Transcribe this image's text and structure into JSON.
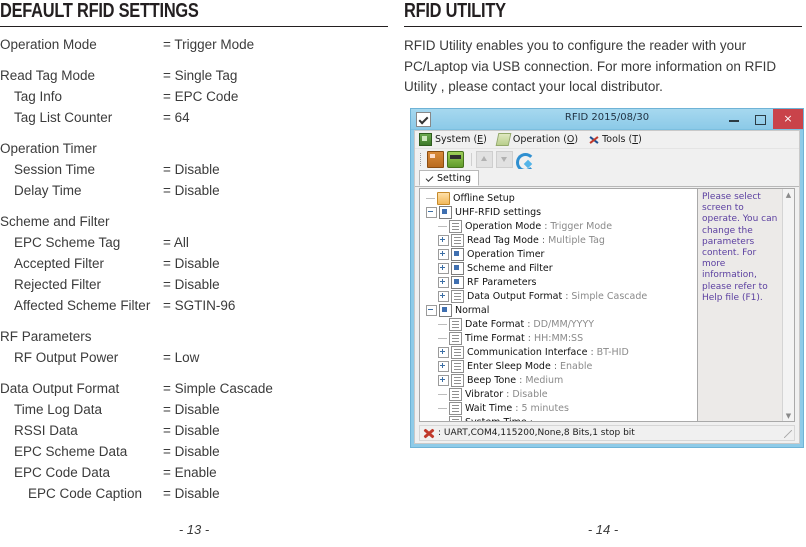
{
  "left": {
    "heading": "DEFAULT RFID SETTINGS",
    "rows": [
      {
        "label": "Operation Mode",
        "value": "= Trigger Mode",
        "indent": 0
      },
      {
        "spacer": true
      },
      {
        "label": "Read Tag Mode",
        "value": "= Single Tag",
        "indent": 0
      },
      {
        "label": "Tag Info",
        "value": "= EPC Code",
        "indent": 1
      },
      {
        "label": "Tag List Counter",
        "value": "= 64",
        "indent": 1
      },
      {
        "spacer": true
      },
      {
        "label": "Operation Timer",
        "value": "",
        "indent": 0
      },
      {
        "label": "Session Time",
        "value": "= Disable",
        "indent": 1
      },
      {
        "label": "Delay Time",
        "value": "= Disable",
        "indent": 1
      },
      {
        "spacer": true
      },
      {
        "label": "Scheme and Filter",
        "value": "",
        "indent": 0
      },
      {
        "label": "EPC Scheme Tag",
        "value": "= All",
        "indent": 1
      },
      {
        "label": "Accepted Filter",
        "value": "= Disable",
        "indent": 1
      },
      {
        "label": "Rejected Filter",
        "value": "= Disable",
        "indent": 1
      },
      {
        "label": "Affected Scheme Filter",
        "value": "= SGTIN-96",
        "indent": 1
      },
      {
        "spacer": true
      },
      {
        "label": "RF Parameters",
        "value": "",
        "indent": 0
      },
      {
        "label": "RF Output Power",
        "value": "= Low",
        "indent": 1
      },
      {
        "spacer": true
      },
      {
        "label": "Data Output Format",
        "value": "= Simple Cascade",
        "indent": 0
      },
      {
        "label": "Time Log Data",
        "value": "= Disable",
        "indent": 1
      },
      {
        "label": "RSSI Data",
        "value": "= Disable",
        "indent": 1
      },
      {
        "label": "EPC Scheme Data",
        "value": "= Disable",
        "indent": 1
      },
      {
        "label": "EPC Code Data",
        "value": "= Enable",
        "indent": 1
      },
      {
        "label": "EPC Code Caption",
        "value": "= Disable",
        "indent": 2
      }
    ],
    "page_number": "- 13 -"
  },
  "right": {
    "heading": "RFID UTILITY",
    "intro": "RFID Utility enables you to configure the reader with your PC/Laptop via USB connection. For more information on RFID Utility , please contact your local distributor.",
    "page_number": "- 14 -"
  },
  "app": {
    "title": "RFID 2015/08/30",
    "window_buttons": {
      "minimize": "–",
      "maximize": "□",
      "close": "×"
    },
    "menu": [
      {
        "text_before": "System (",
        "mnemonic": "E",
        "text_after": ")",
        "icon": "system-icon"
      },
      {
        "text_before": "Operation (",
        "mnemonic": "O",
        "text_after": ")",
        "icon": "operation-icon"
      },
      {
        "text_before": "Tools (",
        "mnemonic": "T",
        "text_after": ")",
        "icon": "tools-icon"
      }
    ],
    "toolbar": [
      {
        "icon": "book-icon",
        "enabled": true
      },
      {
        "icon": "device-icon",
        "enabled": true
      },
      {
        "icon": "upload-icon",
        "enabled": false
      },
      {
        "icon": "download-icon",
        "enabled": false
      },
      {
        "icon": "refresh-icon",
        "enabled": true
      }
    ],
    "tab": {
      "label": "Setting",
      "icon": "check-icon"
    },
    "tree": [
      {
        "depth": 0,
        "expander": "none",
        "icon": "folder-icon",
        "name": "Offline Setup",
        "value": ""
      },
      {
        "depth": 0,
        "expander": "minus",
        "icon": "blue-icon",
        "name": "UHF-RFID settings",
        "value": ""
      },
      {
        "depth": 1,
        "expander": "none",
        "icon": "page-icon",
        "name": "Operation Mode",
        "value": "Trigger Mode"
      },
      {
        "depth": 1,
        "expander": "plus",
        "icon": "page-icon",
        "name": "Read Tag Mode",
        "value": "Multiple Tag"
      },
      {
        "depth": 1,
        "expander": "plus",
        "icon": "blue-icon",
        "name": "Operation Timer",
        "value": ""
      },
      {
        "depth": 1,
        "expander": "plus",
        "icon": "blue-icon",
        "name": "Scheme and Filter",
        "value": ""
      },
      {
        "depth": 1,
        "expander": "plus",
        "icon": "blue-icon",
        "name": "RF Parameters",
        "value": ""
      },
      {
        "depth": 1,
        "expander": "plus",
        "icon": "page-icon",
        "name": "Data Output Format",
        "value": "Simple Cascade"
      },
      {
        "depth": 0,
        "expander": "minus",
        "icon": "blue-icon",
        "name": "Normal",
        "value": ""
      },
      {
        "depth": 1,
        "expander": "none",
        "icon": "page-icon",
        "name": "Date Format",
        "value": "DD/MM/YYYY"
      },
      {
        "depth": 1,
        "expander": "none",
        "icon": "page-icon",
        "name": "Time Format",
        "value": "HH:MM:SS"
      },
      {
        "depth": 1,
        "expander": "plus",
        "icon": "page-icon",
        "name": "Communication Interface",
        "value": "BT-HID"
      },
      {
        "depth": 1,
        "expander": "plus",
        "icon": "page-icon",
        "name": "Enter Sleep Mode",
        "value": "Enable"
      },
      {
        "depth": 1,
        "expander": "plus",
        "icon": "page-icon",
        "name": "Beep Tone",
        "value": "Medium"
      },
      {
        "depth": 1,
        "expander": "none",
        "icon": "page-icon",
        "name": "Vibrator",
        "value": "Disable"
      },
      {
        "depth": 1,
        "expander": "none",
        "icon": "page-icon",
        "name": "Wait Time",
        "value": "5 minutes"
      },
      {
        "depth": 1,
        "expander": "none",
        "icon": "page-icon",
        "name": "System Time",
        "value": ""
      }
    ],
    "help_text": "Please select screen to operate. You can change the parameters content. For more information, please refer to Help file (F1).",
    "status_text": ": UART,COM4,115200,None,8 Bits,1 stop bit",
    "colors": {
      "titlebar": "#8ecbe8",
      "close_button": "#c9434a",
      "help_text": "#5b3fa0",
      "tree_value": "#8a8a8a"
    }
  }
}
